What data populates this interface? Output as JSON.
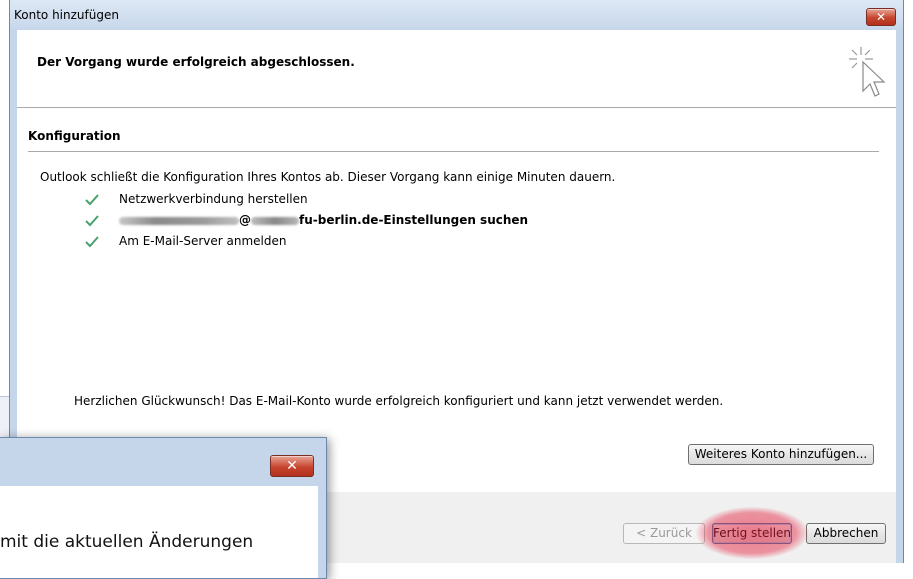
{
  "window": {
    "title": "Konto hinzufügen",
    "close_symbol": "✕",
    "headline": "Der Vorgang wurde erfolgreich abgeschlossen."
  },
  "config": {
    "section_title": "Konfiguration",
    "intro": "Outlook schließt die Konfiguration Ihres Kontos ab. Dieser Vorgang kann einige Minuten dauern.",
    "steps": [
      {
        "label": "Netzwerkverbindung herstellen",
        "status": "done"
      },
      {
        "label_at": "@",
        "label_suffix": "fu-berlin.de-Einstellungen suchen",
        "status": "done"
      },
      {
        "label": "Am E-Mail-Server anmelden",
        "status": "done"
      }
    ],
    "congrats": "Herzlichen Glückwunsch! Das E-Mail-Konto wurde erfolgreich konfiguriert und kann jetzt verwendet werden."
  },
  "buttons": {
    "add_account": "Weiteres Konto hinzufügen...",
    "back": "< Zurück",
    "finish": "Fertig stellen",
    "cancel": "Abbrechen"
  },
  "second_dialog": {
    "close_symbol": "✕",
    "text": "mit die aktuellen Änderungen"
  },
  "colors": {
    "check": "#4aa06e",
    "highlight": "#e11e3c",
    "close_button": "#c7462f"
  },
  "icons": {
    "status": "check-icon",
    "header": "wizard-cursor-icon",
    "close": "close-icon"
  }
}
